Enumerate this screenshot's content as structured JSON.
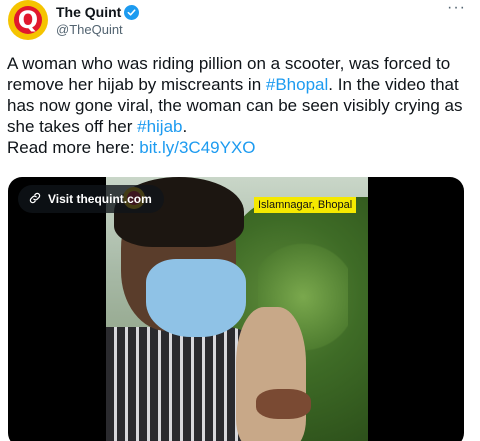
{
  "tweet": {
    "author_name": "The Quint",
    "author_handle": "@TheQuint",
    "verified": true,
    "more_label": "···",
    "text_part1": "A woman who was riding pillion on a scooter, was forced to remove her hijab by miscreants in ",
    "hashtag1": "#Bhopal",
    "text_part2": ". In the video that has now gone viral, the woman can be seen visibly crying as she takes off her ",
    "hashtag2": "#hijab",
    "text_part3": ".",
    "text_part4": "Read more here: ",
    "link": "bit.ly/3C49YXO"
  },
  "media": {
    "visit_label": "Visit thequint.com",
    "location_caption": "Islamnagar, Bhopal"
  },
  "colors": {
    "accent": "#1d9bf0",
    "brand_yellow": "#f5c400",
    "brand_red": "#e0182d"
  },
  "icons": {
    "verified": "verified-badge-icon",
    "more": "more-options-icon",
    "link": "link-icon"
  }
}
